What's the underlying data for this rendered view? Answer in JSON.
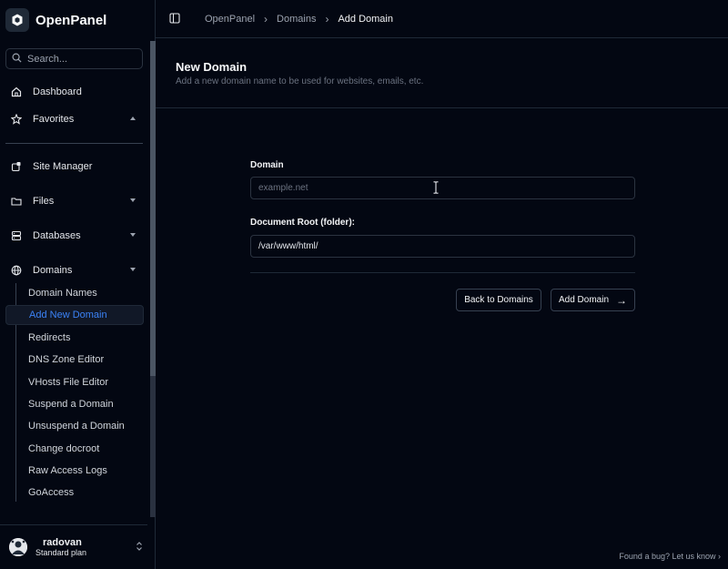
{
  "app": {
    "name": "OpenPanel"
  },
  "search": {
    "placeholder": "Search..."
  },
  "nav": {
    "dashboard": "Dashboard",
    "favorites": "Favorites",
    "site_manager": "Site Manager",
    "files": "Files",
    "databases": "Databases",
    "domains": "Domains"
  },
  "domains_submenu": [
    "Domain Names",
    "Add New Domain",
    "Redirects",
    "DNS Zone Editor",
    "VHosts File Editor",
    "Suspend a Domain",
    "Unsuspend a Domain",
    "Change docroot",
    "Raw Access Logs",
    "GoAccess"
  ],
  "user": {
    "name": "radovan",
    "plan": "Standard plan"
  },
  "breadcrumb": [
    "OpenPanel",
    "Domains",
    "Add Domain"
  ],
  "page": {
    "title": "New Domain",
    "subtitle": "Add a new domain name to be used for websites, emails, etc."
  },
  "form": {
    "domain_label": "Domain",
    "domain_placeholder": "example.net",
    "docroot_label": "Document Root (folder):",
    "docroot_value": "/var/www/html/",
    "back_button": "Back to Domains",
    "add_button": "Add Domain",
    "add_arrow": "→"
  },
  "footer": {
    "bug_link": "Found a bug? Let us know ›"
  },
  "colors": {
    "background": "#030712",
    "accent": "#3b82f6",
    "border": "#1f2937"
  }
}
